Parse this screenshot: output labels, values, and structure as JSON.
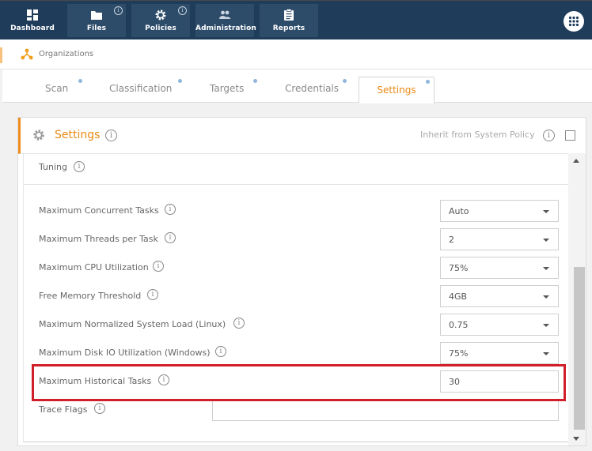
{
  "nav": {
    "items": [
      {
        "label": "Dashboard",
        "icon": "dashboard-icon",
        "info": false
      },
      {
        "label": "Files",
        "icon": "folder-icon",
        "info": true
      },
      {
        "label": "Policies",
        "icon": "gear-icon",
        "info": true
      },
      {
        "label": "Administration",
        "icon": "users-icon",
        "info": false
      },
      {
        "label": "Reports",
        "icon": "clipboard-icon",
        "info": false
      }
    ],
    "info_glyph": "i"
  },
  "breadcrumb": {
    "label": "Organizations",
    "icon": "organizations-icon"
  },
  "tabs": [
    {
      "label": "Scan"
    },
    {
      "label": "Classification"
    },
    {
      "label": "Targets"
    },
    {
      "label": "Credentials"
    },
    {
      "label": "Settings",
      "active": true
    }
  ],
  "card": {
    "title": "Settings",
    "inherit_label": "Inherit from System Policy",
    "inherit_checked": false,
    "section": "Tuning"
  },
  "rows": [
    {
      "label": "Maximum Concurrent Tasks",
      "value": "Auto",
      "type": "select"
    },
    {
      "label": "Maximum Threads per Task",
      "value": "2",
      "type": "select"
    },
    {
      "label": "Maximum CPU Utilization",
      "value": "75%",
      "type": "select"
    },
    {
      "label": "Free Memory Threshold",
      "value": "4GB",
      "type": "select"
    },
    {
      "label": "Maximum Normalized System Load (Linux)",
      "value": "0.75",
      "type": "select"
    },
    {
      "label": "Maximum Disk IO Utilization (Windows)",
      "value": "75%",
      "type": "select"
    },
    {
      "label": "Maximum Historical Tasks",
      "value": "30",
      "type": "text"
    },
    {
      "label": "Trace Flags",
      "value": "",
      "type": "text"
    }
  ],
  "colors": {
    "nav_bg": "#1f3d5b",
    "accent": "#e88a14",
    "highlight": "#d11f2a"
  }
}
